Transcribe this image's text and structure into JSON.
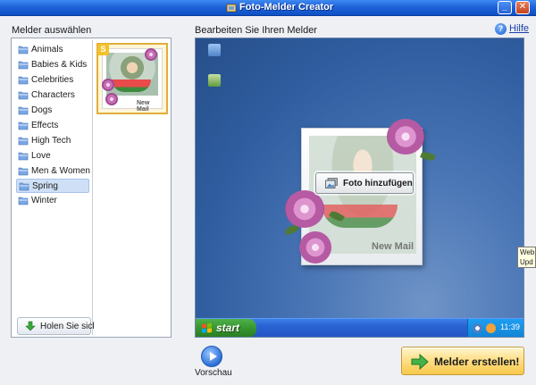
{
  "window": {
    "title": "Foto-Melder Creator",
    "minimize": "_",
    "close": "✕"
  },
  "left": {
    "heading": "Melder auswählen",
    "categories": [
      {
        "label": "Animals"
      },
      {
        "label": "Babies & Kids"
      },
      {
        "label": "Celebrities"
      },
      {
        "label": "Characters"
      },
      {
        "label": "Dogs"
      },
      {
        "label": "Effects"
      },
      {
        "label": "High Tech"
      },
      {
        "label": "Love"
      },
      {
        "label": "Men & Women"
      },
      {
        "label": "Spring",
        "selected": true
      },
      {
        "label": "Winter"
      }
    ],
    "get_more": "Holen Sie sich",
    "thumbnail": {
      "badge": "S",
      "caption": "New Mail"
    }
  },
  "editor": {
    "heading": "Bearbeiten Sie Ihren Melder",
    "help": "Hilfe",
    "card_title": "New Mail",
    "add_photo": "Foto hinzufügen",
    "taskbar": {
      "start": "start",
      "clock": "11:39"
    }
  },
  "tooltip": {
    "line1": "Web",
    "line2": "Upd"
  },
  "bottom": {
    "preview": "Vorschau",
    "create": "Melder erstellen!"
  },
  "colors": {
    "titlebar": "#1f63d8",
    "accent_button": "#f7c84a",
    "selected_row": "#cfe0f6",
    "start_green": "#36952f"
  },
  "icons": {
    "category": "folder-icon",
    "help": "help-icon",
    "preview": "play-icon",
    "create": "arrow-right-icon"
  }
}
